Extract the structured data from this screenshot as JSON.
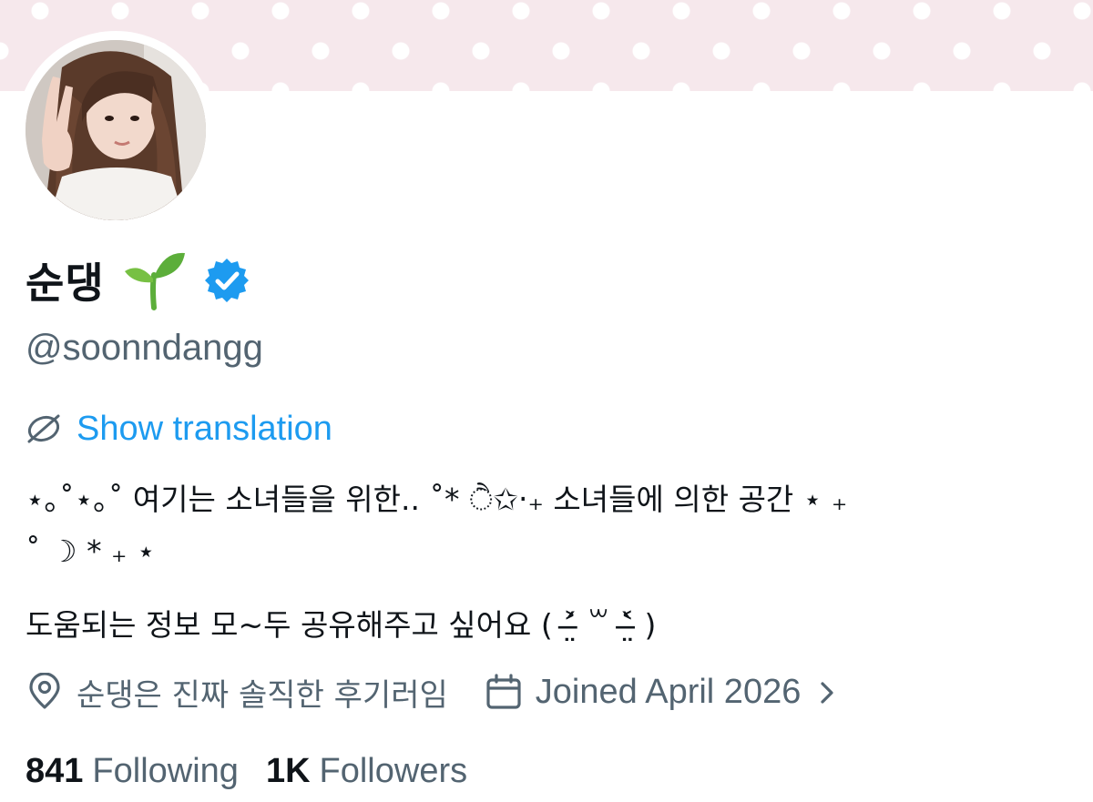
{
  "profile": {
    "display_name": "순댕",
    "handle": "@soonndangg",
    "name_emoji_icon": "sprout-icon",
    "verified_icon": "verified-badge-icon",
    "show_translation": "Show translation",
    "bio": [
      "⋆｡˚⋆｡˚ 여기는 소녀들을 위한.. ˚* ੈ✩‧₊ 소녀들에 의한 공간 ⋆ ₊",
      "˚ ☽ * ₊ ⋆",
      "도움되는 정보 모~두 공유해주고 싶어요 ( ˃̶̤́ ꒳ ˂̶̤̀ )"
    ],
    "location": "순댕은 진짜 솔직한 후기러임",
    "joined": "Joined April 2026",
    "following_count": "841",
    "following_label": "Following",
    "followers_count": "1K",
    "followers_label": "Followers"
  },
  "colors": {
    "banner": "#f6e8ec",
    "link": "#1d9bf0",
    "secondary_text": "#536471",
    "primary_text": "#0f1419",
    "verified": "#1d9bf0"
  }
}
